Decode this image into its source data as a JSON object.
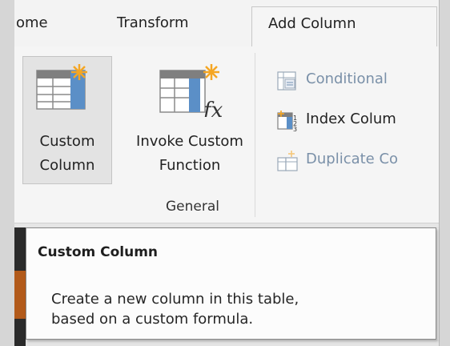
{
  "tabs": [
    {
      "label": "ome"
    },
    {
      "label": "Transform"
    },
    {
      "label": "Add Column",
      "active": true
    }
  ],
  "ribbon": {
    "custom_column": {
      "line1": "Custom",
      "line2": "Column",
      "icon": "custom-column-icon"
    },
    "invoke_custom_function": {
      "line1": "Invoke Custom",
      "line2": "Function",
      "icon": "fx-function-icon"
    },
    "small_buttons": [
      {
        "label": "Conditional",
        "icon": "conditional-column-icon",
        "enabled": false
      },
      {
        "label": "Index Colum",
        "icon": "index-column-icon",
        "enabled": true
      },
      {
        "label": "Duplicate Co",
        "icon": "duplicate-column-icon",
        "enabled": false
      }
    ],
    "group_label": "General"
  },
  "tooltip": {
    "title": "Custom Column",
    "line1": "Create a new column in this table,",
    "line2": "based on a custom formula."
  },
  "colors": {
    "accent_star": "#f5a623",
    "disabled_text": "#7a90a8",
    "icon_blue": "#5b8fc7"
  }
}
